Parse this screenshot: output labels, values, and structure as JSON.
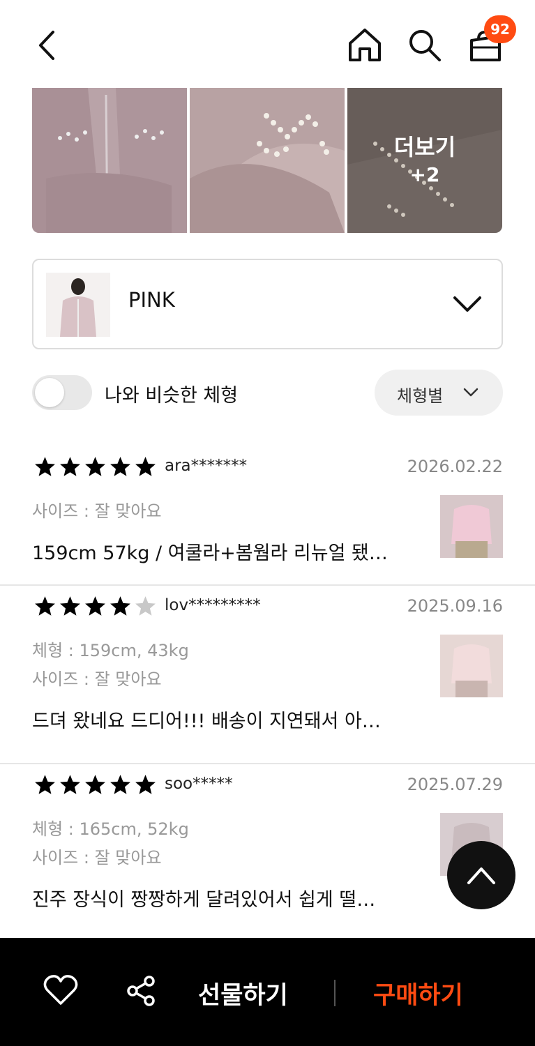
{
  "header": {
    "cart_count": "92"
  },
  "photos": {
    "more_label": "더보기",
    "more_count": "+2"
  },
  "option": {
    "selected": "PINK"
  },
  "filter": {
    "toggle_label": "나와 비슷한 체형",
    "sort_label": "체형별"
  },
  "reviews": [
    {
      "rating": 5,
      "user": "ara*******",
      "date": "2026.02.22",
      "body": "",
      "size": "사이즈 : 잘 맞아요",
      "text": "159cm 57kg / 여쿨라+봄웜라 리뉴얼 됐…"
    },
    {
      "rating": 4,
      "user": "lov*********",
      "date": "2025.09.16",
      "body": "체형 : 159cm, 43kg",
      "size": "사이즈 : 잘 맞아요",
      "text": "드뎌 왔네요 드디어!!! 배송이 지연돼서 아…"
    },
    {
      "rating": 5,
      "user": "soo*****",
      "date": "2025.07.29",
      "body": "체형 : 165cm, 52kg",
      "size": "사이즈 : 잘 맞아요",
      "text": "진주 장식이 짱짱하게 달려있어서 쉽게 떨…"
    }
  ],
  "bottom_bar": {
    "gift_label": "선물하기",
    "buy_label": "구매하기"
  },
  "colors": {
    "accent": "#ff4b12",
    "bar_bg": "#000000"
  },
  "icons": [
    "back-icon",
    "home-icon",
    "search-icon",
    "cart-icon",
    "chevron-down-icon",
    "star-icon",
    "arrow-up-icon",
    "heart-icon",
    "share-icon"
  ]
}
